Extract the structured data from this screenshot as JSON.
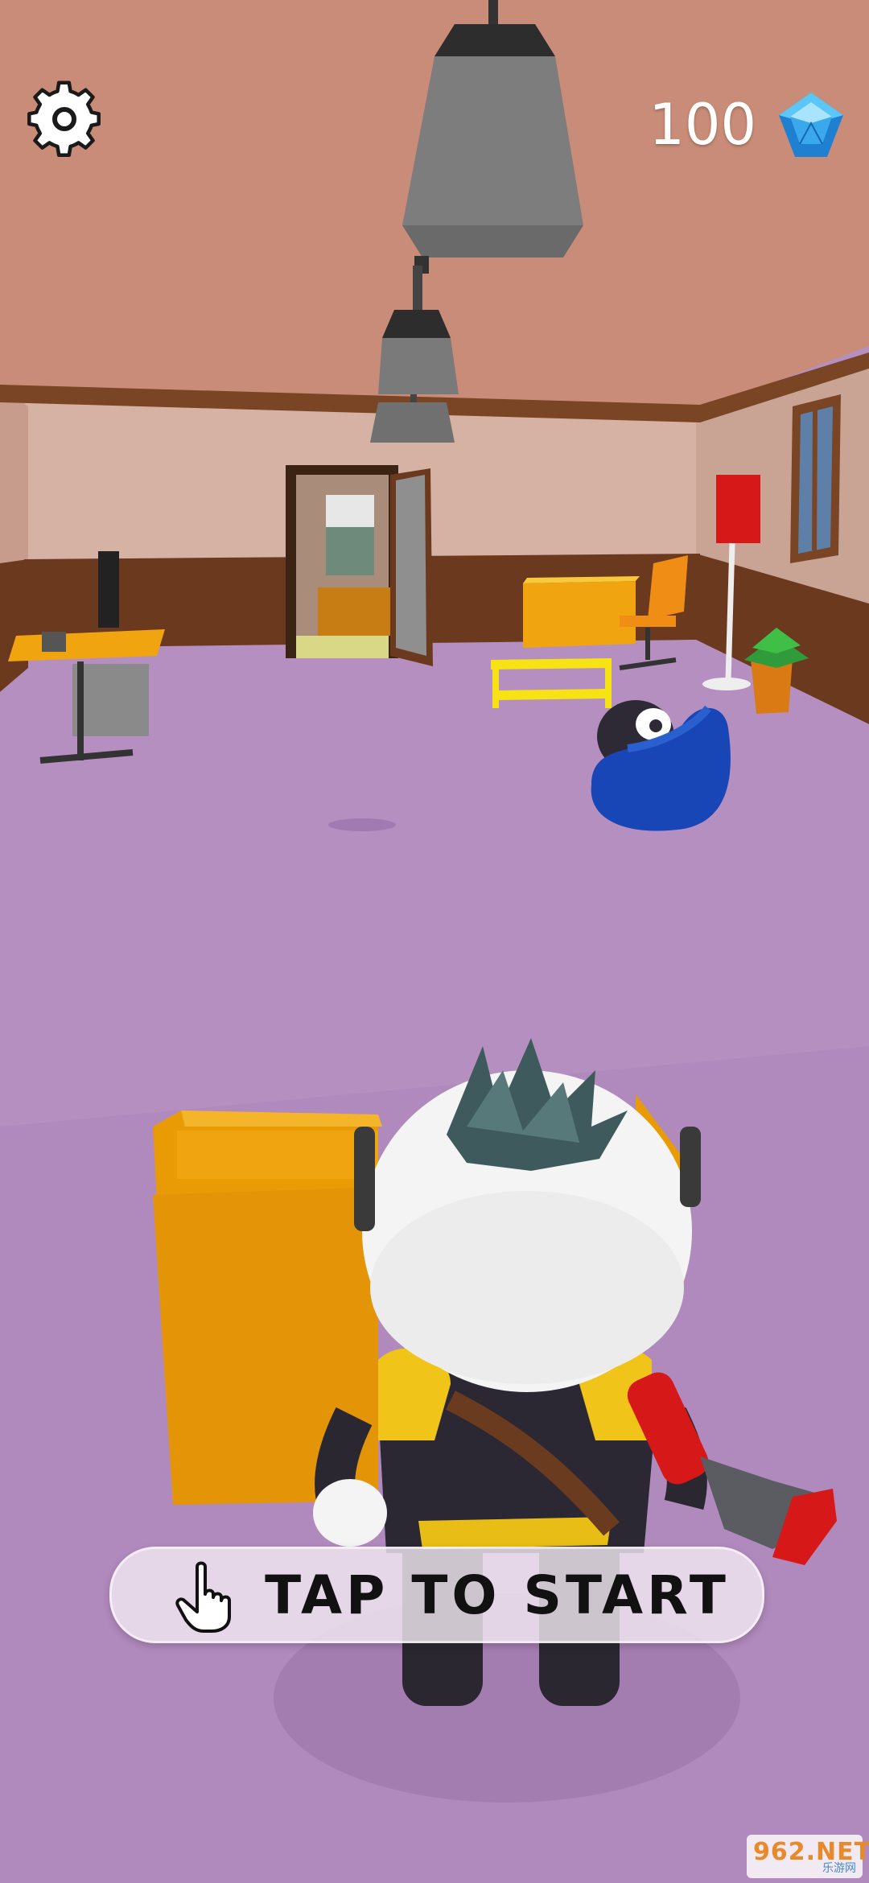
{
  "hud": {
    "settings_icon": "gear-icon",
    "gem_count": "100",
    "gem_icon": "blue-gem-icon"
  },
  "start_prompt": {
    "label": "TAP TO START",
    "icon": "tap-hand-icon"
  },
  "watermark": {
    "logo_text": "962.NET",
    "caption": "乐游网"
  },
  "colors": {
    "floor": "#b58fc0",
    "ceiling": "#c98c78",
    "wall": "#c9a394",
    "accent_yellow": "#f0a40f",
    "gem_blue": "#3aa8ec"
  }
}
